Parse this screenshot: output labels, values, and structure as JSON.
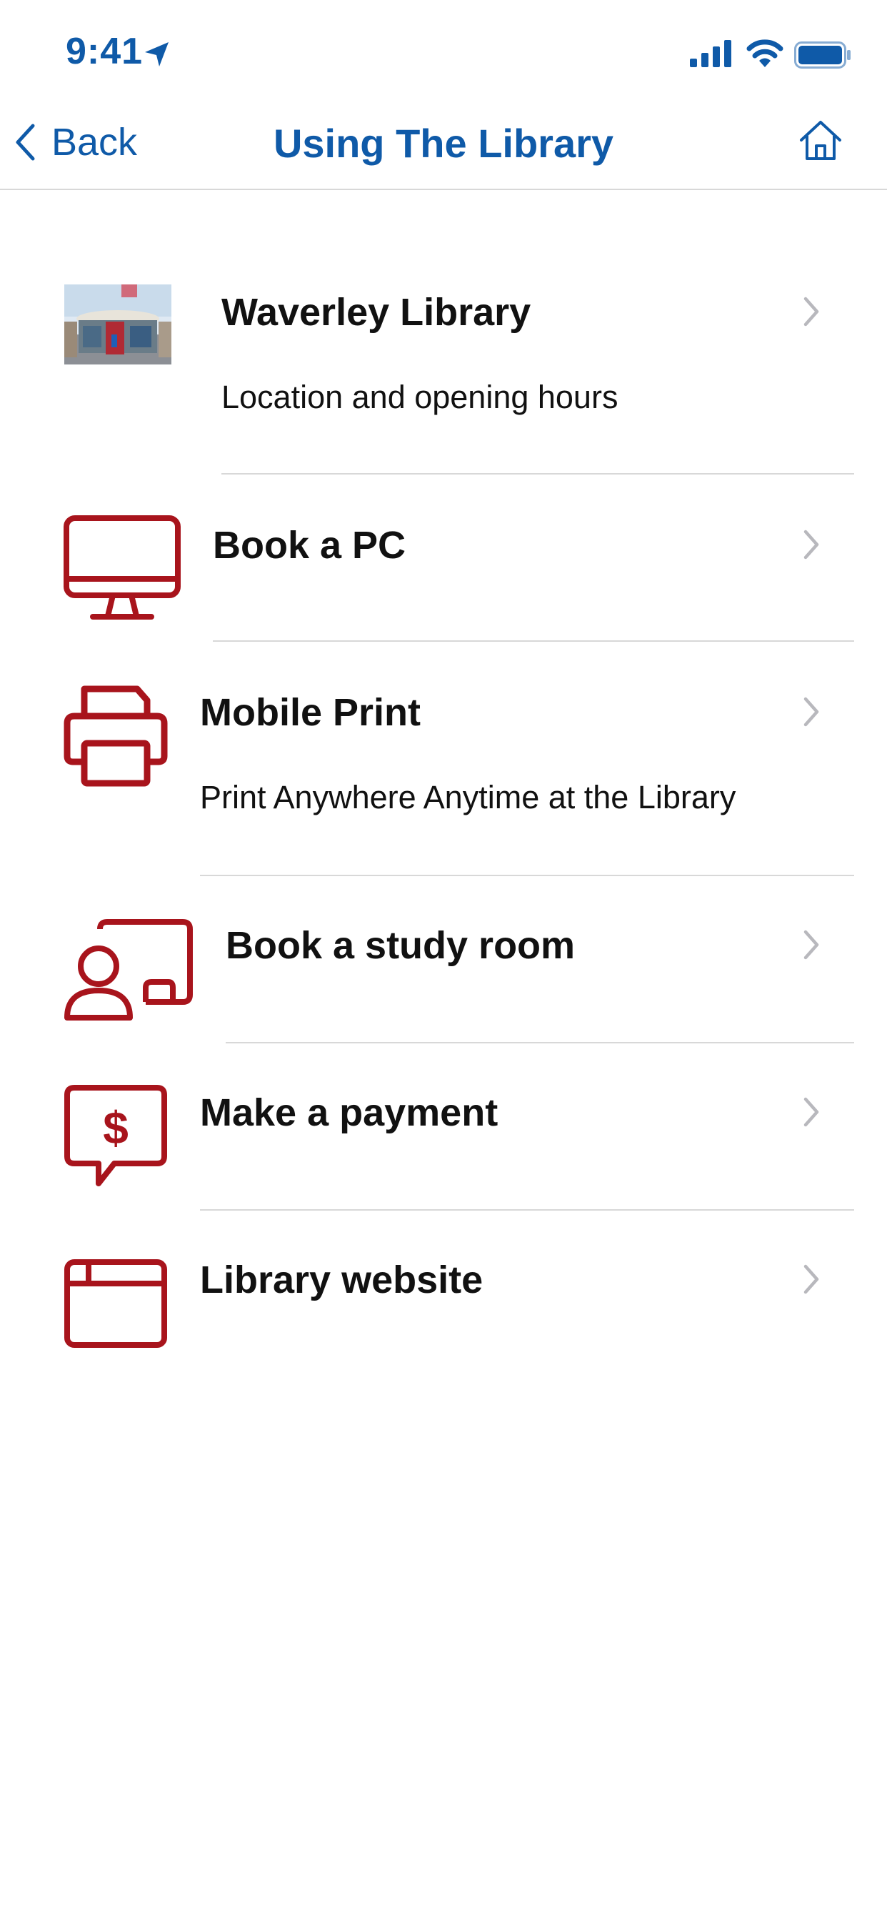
{
  "status_bar": {
    "time": "9:41"
  },
  "nav": {
    "back_label": "Back",
    "title": "Using The Library"
  },
  "colors": {
    "accent_blue": "#0f5aa8",
    "icon_red": "#a8141c",
    "chevron_gray": "#b8b8bd",
    "separator": "#d8d8d8"
  },
  "items": [
    {
      "title": "Waverley Library",
      "subtitle": "Location and opening hours",
      "icon": "library-photo"
    },
    {
      "title": "Book a PC",
      "icon": "desktop-computer-icon"
    },
    {
      "title": "Mobile Print",
      "subtitle": "Print Anywhere Anytime at the Library",
      "icon": "printer-icon"
    },
    {
      "title": "Book a study room",
      "icon": "person-presentation-icon"
    },
    {
      "title": "Make a payment",
      "icon": "dollar-chat-icon"
    },
    {
      "title": "Library website",
      "icon": "browser-window-icon"
    }
  ]
}
